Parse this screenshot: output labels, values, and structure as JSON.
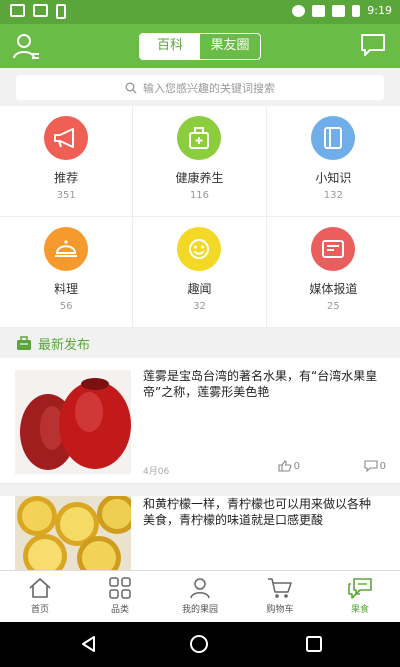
{
  "status_bar": {
    "time": "9:19"
  },
  "header": {
    "tabs": [
      {
        "label": "百科",
        "active": true
      },
      {
        "label": "果友圈",
        "active": false
      }
    ]
  },
  "search": {
    "placeholder": "输入您感兴趣的关键词搜索"
  },
  "categories": [
    {
      "name": "推荐",
      "count": "351",
      "color": "#ef5f53",
      "icon": "megaphone-icon"
    },
    {
      "name": "健康养生",
      "count": "116",
      "color": "#8ccd3e",
      "icon": "medical-bag-icon"
    },
    {
      "name": "小知识",
      "count": "132",
      "color": "#6faee9",
      "icon": "book-icon"
    },
    {
      "name": "料理",
      "count": "56",
      "color": "#f79a2e",
      "icon": "cloche-icon"
    },
    {
      "name": "趣闻",
      "count": "32",
      "color": "#f4d826",
      "icon": "smile-icon"
    },
    {
      "name": "媒体报道",
      "count": "25",
      "color": "#ea5e5e",
      "icon": "newspaper-icon"
    }
  ],
  "section": {
    "title": "最新发布"
  },
  "articles": [
    {
      "title": "莲雾是宝岛台湾的著名水果，有“台湾水果皇帝”之称，莲雾形美色艳",
      "meta": "4月06",
      "likes": "0",
      "comments": "0"
    },
    {
      "title": "和黄柠檬一样，青柠檬也可以用来做以各种美食，青柠檬的味道就是口感更酸"
    }
  ],
  "tabbar": [
    {
      "label": "首页",
      "icon": "home-icon",
      "active": false
    },
    {
      "label": "品类",
      "icon": "grid-icon",
      "active": false
    },
    {
      "label": "我的果园",
      "icon": "person-icon",
      "active": false
    },
    {
      "label": "购物车",
      "icon": "cart-icon",
      "active": false
    },
    {
      "label": "果食",
      "icon": "chat-icon",
      "active": true
    }
  ],
  "colors": {
    "primary": "#69bc45",
    "primary_dark": "#5aa63a"
  }
}
